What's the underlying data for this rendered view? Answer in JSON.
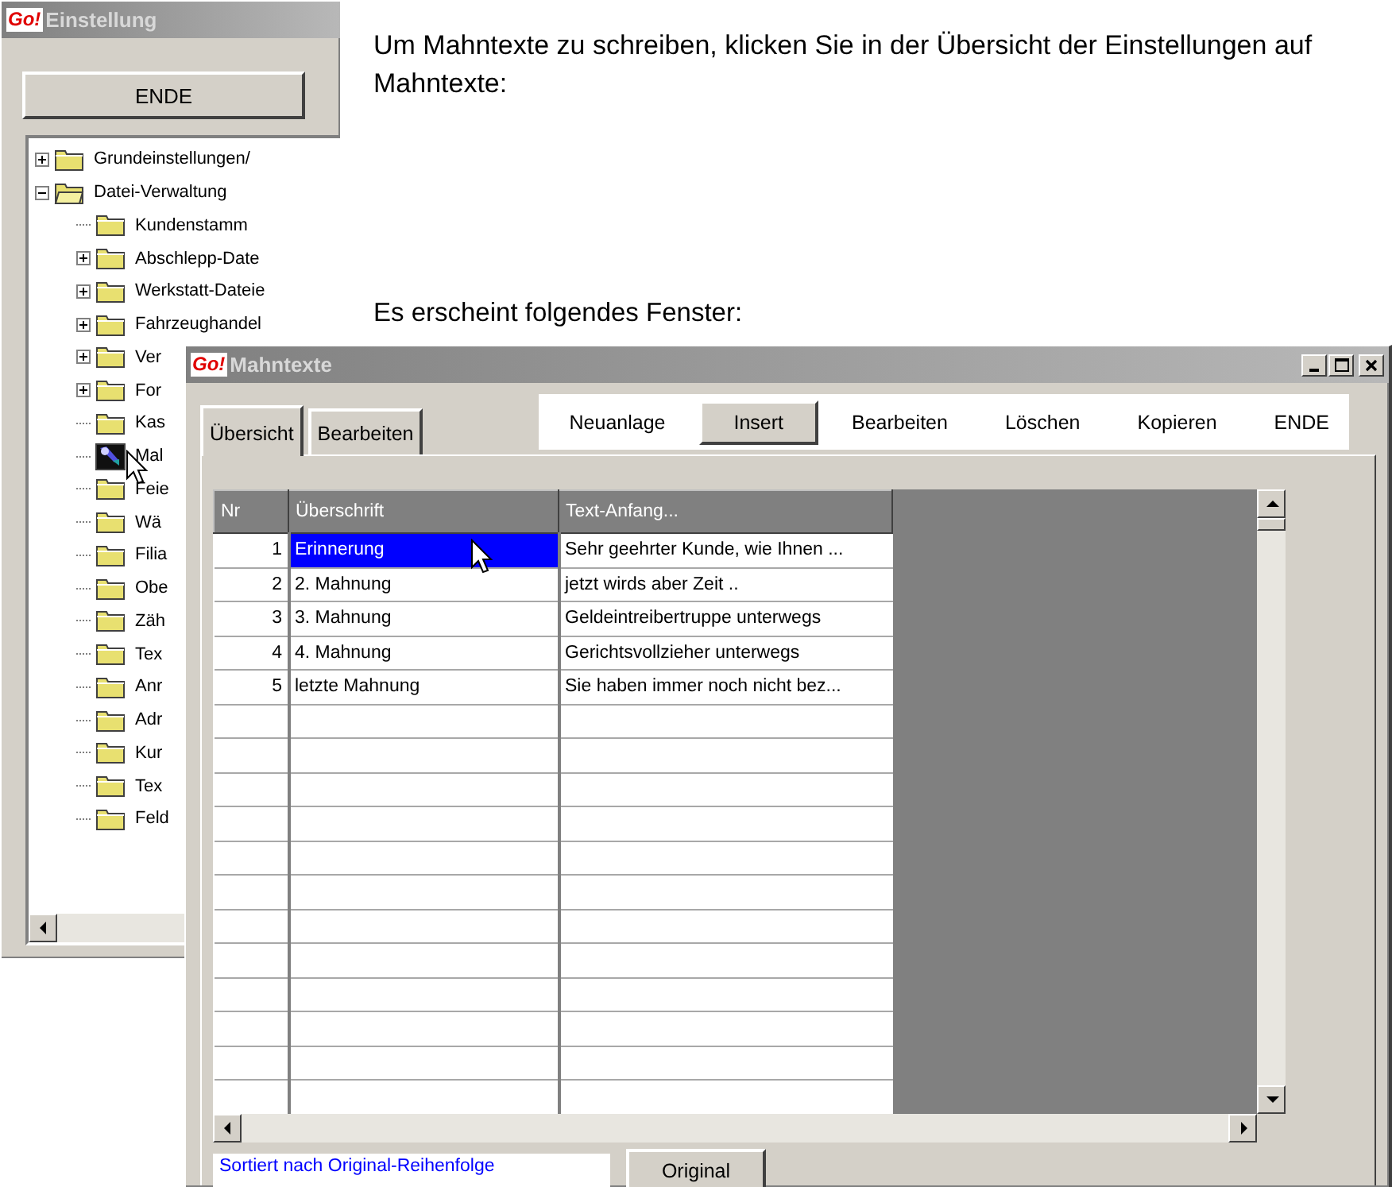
{
  "intro": "Um Mahntexte zu schreiben, klicken Sie in der Übersicht der Einstellungen auf Mahntexte:",
  "caption": "Es erscheint folgendes Fenster:",
  "settings_window": {
    "logo": "Go!",
    "title": "Einstellung",
    "end_button": "ENDE",
    "tree": [
      {
        "label": "Grundeinstellungen/",
        "has_children": true,
        "expanded": false,
        "selected": false
      },
      {
        "label": "Datei-Verwaltung",
        "has_children": true,
        "expanded": true,
        "selected": false,
        "children": [
          {
            "label": "Kundenstamm",
            "has_children": false,
            "expanded": false,
            "selected": false
          },
          {
            "label": "Abschlepp-Date",
            "has_children": true,
            "expanded": false,
            "selected": false
          },
          {
            "label": "Werkstatt-Dateie",
            "has_children": true,
            "expanded": false,
            "selected": false
          },
          {
            "label": "Fahrzeughandel",
            "has_children": true,
            "expanded": false,
            "selected": false
          },
          {
            "label": "Ver",
            "has_children": true,
            "expanded": false,
            "selected": false
          },
          {
            "label": "For",
            "has_children": true,
            "expanded": false,
            "selected": false
          },
          {
            "label": "Kas",
            "has_children": false,
            "expanded": false,
            "selected": false
          },
          {
            "label": "Mal",
            "has_children": false,
            "expanded": false,
            "selected": true
          },
          {
            "label": "Feie",
            "has_children": false,
            "expanded": false,
            "selected": false
          },
          {
            "label": "Wä",
            "has_children": false,
            "expanded": false,
            "selected": false
          },
          {
            "label": "Filia",
            "has_children": false,
            "expanded": false,
            "selected": false
          },
          {
            "label": "Obe",
            "has_children": false,
            "expanded": false,
            "selected": false
          },
          {
            "label": "Zäh",
            "has_children": false,
            "expanded": false,
            "selected": false
          },
          {
            "label": "Tex",
            "has_children": false,
            "expanded": false,
            "selected": false
          },
          {
            "label": "Anr",
            "has_children": false,
            "expanded": false,
            "selected": false
          },
          {
            "label": "Adr",
            "has_children": false,
            "expanded": false,
            "selected": false
          },
          {
            "label": "Kur",
            "has_children": false,
            "expanded": false,
            "selected": false
          },
          {
            "label": "Tex",
            "has_children": false,
            "expanded": false,
            "selected": false
          },
          {
            "label": "Feld",
            "has_children": false,
            "expanded": false,
            "selected": false
          }
        ]
      }
    ]
  },
  "texts_window": {
    "logo": "Go!",
    "title": "Mahntexte",
    "tabs": [
      {
        "label": "Übersicht",
        "selected": true
      },
      {
        "label": "Bearbeiten",
        "selected": false
      }
    ],
    "toolbar": [
      {
        "label": "Neuanlage",
        "raised": false
      },
      {
        "label": "Insert",
        "raised": true
      },
      {
        "label": "Bearbeiten",
        "raised": false
      },
      {
        "label": "Löschen",
        "raised": false
      },
      {
        "label": "Kopieren",
        "raised": false
      },
      {
        "label": "ENDE",
        "raised": false
      }
    ],
    "table": {
      "columns": [
        "Nr",
        "Überschrift",
        "Text-Anfang..."
      ],
      "rows": [
        {
          "nr": "1",
          "heading": "Erinnerung",
          "text_start": "Sehr geehrter Kunde, wie Ihnen ...",
          "selected": true
        },
        {
          "nr": "2",
          "heading": "2. Mahnung",
          "text_start": "jetzt wirds aber Zeit ..",
          "selected": false
        },
        {
          "nr": "3",
          "heading": "3. Mahnung",
          "text_start": "Geldeintreibertruppe unterwegs",
          "selected": false
        },
        {
          "nr": "4",
          "heading": "4. Mahnung",
          "text_start": "Gerichtsvollzieher unterwegs",
          "selected": false
        },
        {
          "nr": "5",
          "heading": "letzte Mahnung",
          "text_start": "Sie haben immer noch nicht bez...",
          "selected": false
        }
      ]
    },
    "status": "Sortiert nach Original-Reihenfolge",
    "original_button": "Original"
  }
}
